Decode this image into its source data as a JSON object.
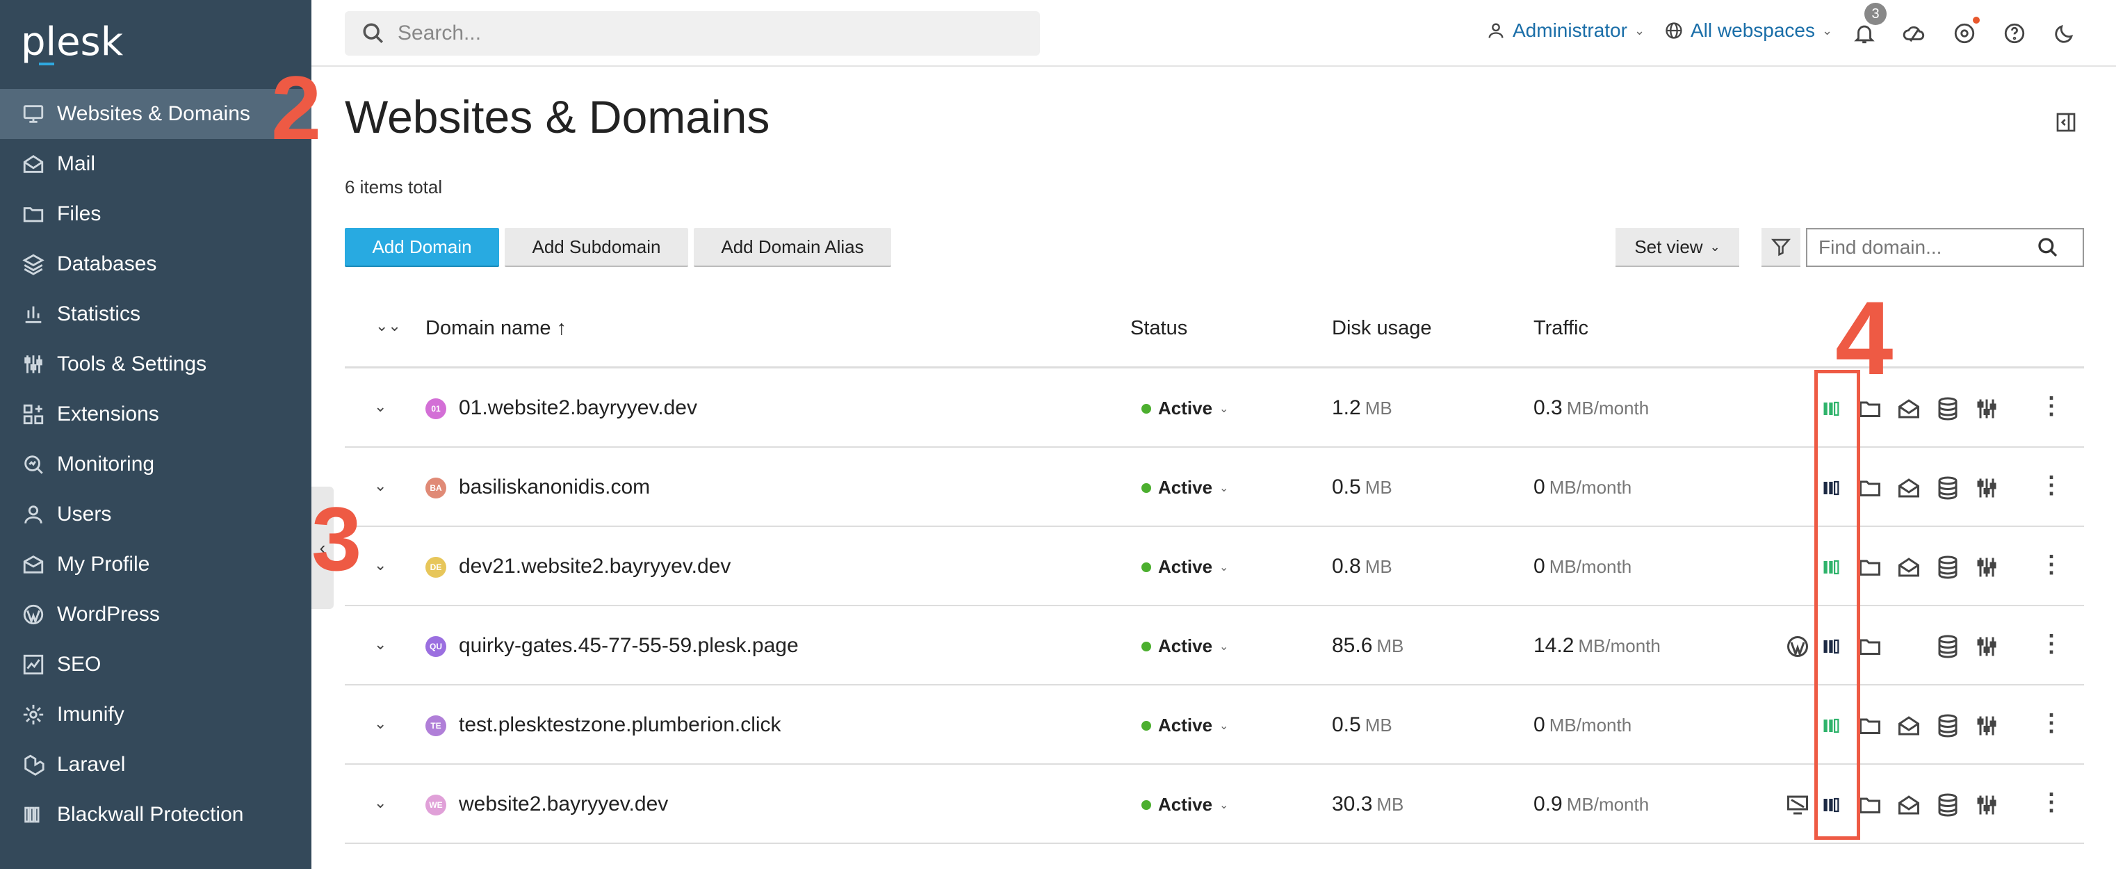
{
  "app": {
    "logo": "plesk"
  },
  "sidebar": {
    "items": [
      {
        "label": "Websites & Domains",
        "icon": "monitor-icon",
        "active": true
      },
      {
        "label": "Mail",
        "icon": "mail-icon"
      },
      {
        "label": "Files",
        "icon": "folder-icon"
      },
      {
        "label": "Databases",
        "icon": "layers-icon"
      },
      {
        "label": "Statistics",
        "icon": "bar-chart-icon"
      },
      {
        "label": "Tools & Settings",
        "icon": "sliders-icon"
      },
      {
        "label": "Extensions",
        "icon": "grid-icon"
      },
      {
        "label": "Monitoring",
        "icon": "magnifier-icon"
      },
      {
        "label": "Users",
        "icon": "user-icon"
      },
      {
        "label": "My Profile",
        "icon": "profile-icon"
      },
      {
        "label": "WordPress",
        "icon": "wordpress-icon"
      },
      {
        "label": "SEO",
        "icon": "seo-chart-icon"
      },
      {
        "label": "Imunify",
        "icon": "gear-icon"
      },
      {
        "label": "Laravel",
        "icon": "laravel-icon"
      },
      {
        "label": "Blackwall Protection",
        "icon": "blackwall-icon"
      }
    ]
  },
  "topbar": {
    "search_placeholder": "Search...",
    "user_label": "Administrator",
    "webspace_label": "All webspaces",
    "notifications_count": "3"
  },
  "main": {
    "title": "Websites & Domains",
    "items_total": "6 items total",
    "buttons": {
      "add_domain": "Add Domain",
      "add_subdomain": "Add Subdomain",
      "add_domain_alias": "Add Domain Alias",
      "set_view": "Set view"
    },
    "find_placeholder": "Find domain...",
    "columns": {
      "domain": "Domain name ↑",
      "status": "Status",
      "disk": "Disk usage",
      "traffic": "Traffic"
    },
    "rows": [
      {
        "initials": "01",
        "color": "#d36fd6",
        "domain": "01.website2.bayryyev.dev",
        "status": "Active",
        "disk": "1.2",
        "disk_unit": "MB",
        "traffic": "0.3",
        "traffic_unit": "MB/month",
        "bw_color": "#2fb36b",
        "mail": true,
        "extra": ""
      },
      {
        "initials": "BA",
        "color": "#e08a76",
        "domain": "basiliskanonidis.com",
        "status": "Active",
        "disk": "0.5",
        "disk_unit": "MB",
        "traffic": "0",
        "traffic_unit": "MB/month",
        "bw_color": "#1d2a44",
        "mail": true,
        "extra": ""
      },
      {
        "initials": "DE",
        "color": "#e7c65a",
        "domain": "dev21.website2.bayryyev.dev",
        "status": "Active",
        "disk": "0.8",
        "disk_unit": "MB",
        "traffic": "0",
        "traffic_unit": "MB/month",
        "bw_color": "#2fb36b",
        "mail": true,
        "extra": ""
      },
      {
        "initials": "QU",
        "color": "#9b6fe0",
        "domain": "quirky-gates.45-77-55-59.plesk.page",
        "status": "Active",
        "disk": "85.6",
        "disk_unit": "MB",
        "traffic": "14.2",
        "traffic_unit": "MB/month",
        "bw_color": "#1d2a44",
        "mail": false,
        "extra": "wordpress-icon"
      },
      {
        "initials": "TE",
        "color": "#b07fd8",
        "domain": "test.plesktestzone.plumberion.click",
        "status": "Active",
        "disk": "0.5",
        "disk_unit": "MB",
        "traffic": "0",
        "traffic_unit": "MB/month",
        "bw_color": "#2fb36b",
        "mail": true,
        "extra": ""
      },
      {
        "initials": "WE",
        "color": "#e0a0d8",
        "domain": "website2.bayryyev.dev",
        "status": "Active",
        "disk": "30.3",
        "disk_unit": "MB",
        "traffic": "0.9",
        "traffic_unit": "MB/month",
        "bw_color": "#1d2a44",
        "mail": true,
        "extra": "screen-icon"
      }
    ]
  },
  "annotations": {
    "a2": "2",
    "a3": "3",
    "a4": "4",
    "color": "#ee5a44"
  }
}
